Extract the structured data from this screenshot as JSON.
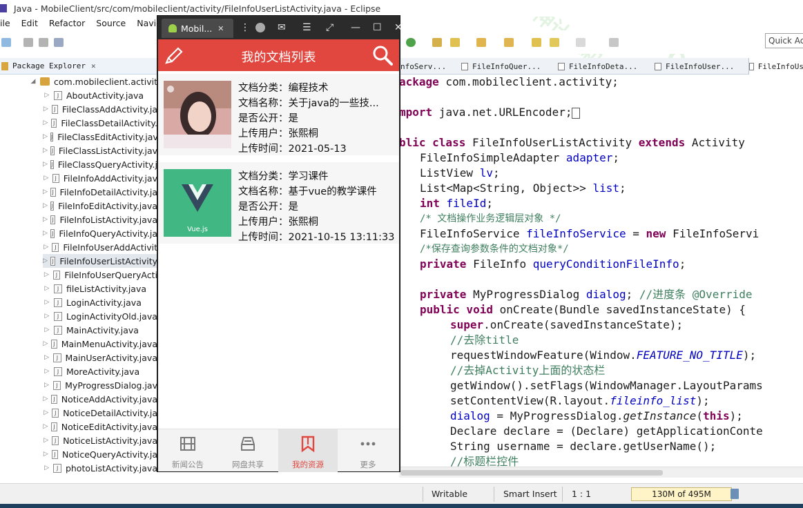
{
  "window": {
    "title": "Java - MobileClient/src/com/mobileclient/activity/FileInfoUserListActivity.java - Eclipse"
  },
  "menu": [
    "ile",
    "Edit",
    "Refactor",
    "Source",
    "Navigat"
  ],
  "quick_access": {
    "placeholder": "Quick Ac"
  },
  "package_explorer": {
    "title": "Package Explorer",
    "close": "✕",
    "package": "com.mobileclient.activity",
    "files": [
      "AboutActivity.java",
      "FileClassAddActivity.ja",
      "FileClassDetailActivity.",
      "FileClassEditActivity.jav",
      "FileClassListActivity.jav",
      "FileClassQueryActivity.j",
      "FileInfoAddActivity.jav",
      "FileInfoDetailActivity.ja",
      "FileInfoEditActivity.java",
      "FileInfoListActivity.java",
      "FileInfoQueryActivity.ja",
      "FileInfoUserAddActivit",
      "FileInfoUserListActivity",
      "FileInfoUserQueryActi",
      "fileListActivity.java",
      "LoginActivity.java",
      "LoginActivityOld.java",
      "MainActivity.java",
      "MainMenuActivity.java",
      "MainUserActivity.java",
      "MoreActivity.java",
      "MyProgressDialog.jav",
      "NoticeAddActivity.java",
      "NoticeDetailActivity.ja",
      "NoticeEditActivity.java",
      "NoticeListActivity.java",
      "NoticeQueryActivity.ja",
      "photoListActivity.java"
    ],
    "selected_index": 12
  },
  "editor_tabs": [
    "nfoServ...",
    "FileInfoQuer...",
    "FileInfoDeta...",
    "FileInfoUser...",
    "FileInfoUs"
  ],
  "code": {
    "l1": {
      "kw": "ackage",
      "rest": " com.mobileclient.activity;"
    },
    "l2": {
      "kw": "mport",
      "rest": " java.net.URLEncoder;"
    },
    "l3": {
      "kw1": "blic class",
      "mid": " FileInfoUserListActivity ",
      "kw2": "extends",
      "rest": " Activity"
    },
    "l4": {
      "type": "FileInfoSimpleAdapter ",
      "fld": "adapter",
      "end": ";"
    },
    "l5": {
      "type": "ListView ",
      "fld": "lv",
      "end": ";"
    },
    "l6": {
      "type": "List<Map<String, Object>> ",
      "fld": "list",
      "end": ";"
    },
    "l7": {
      "kw": "int ",
      "fld": "fileId",
      "end": ";"
    },
    "l8": {
      "cm": "/* 文档操作业务逻辑层对象 */"
    },
    "l9": {
      "type": "FileInfoService ",
      "fld": "fileInfoService",
      "mid": " = ",
      "kw": "new",
      "rest": " FileInfoServi"
    },
    "l10": {
      "cm": "/*保存查询参数条件的文档对象*/"
    },
    "l11": {
      "kw": "private",
      "type": " FileInfo ",
      "fld": "queryConditionFileInfo",
      "end": ";"
    },
    "l12": {
      "kw": "private",
      "type": " MyProgressDialog ",
      "fld": "dialog",
      "end": "; ",
      "cm": "//进度条 @Override"
    },
    "l13": {
      "kw": "public void",
      "rest": " onCreate(Bundle savedInstanceState) {"
    },
    "l14": {
      "kw": "super",
      "rest": ".onCreate(savedInstanceState);"
    },
    "l15": {
      "cm": "//去除title"
    },
    "l16": {
      "a": "requestWindowFeature(Window.",
      "it": "FEATURE_NO_TITLE",
      "b": ");"
    },
    "l17": {
      "cm": "//去掉Activity上面的状态栏"
    },
    "l18": {
      "a": "getWindow().setFlags(WindowManager.LayoutParams"
    },
    "l19": {
      "a": "setContentView(R.layout.",
      "it": "fileinfo_list",
      "b": ");"
    },
    "l20": {
      "fld": "dialog",
      "a": " = MyProgressDialog.",
      "it": "getInstance",
      "b": "(",
      "kw": "this",
      "c": ");"
    },
    "l21": {
      "a": "Declare declare = (Declare) getApplicationConte"
    },
    "l22": {
      "a": "String username = declare.getUserName();"
    },
    "l23": {
      "cm": "//标题栏控件"
    }
  },
  "status": {
    "writable": "Writable",
    "insert": "Smart Insert",
    "position": "1 : 1",
    "memory": "130M of 495M"
  },
  "emulator": {
    "tab_label": "Mobil...",
    "tab_close": "✕",
    "close": "✕"
  },
  "app": {
    "title": "我的文档列表",
    "accent": "#e1463f",
    "documents": [
      {
        "category": "文档分类：编程技术",
        "name": "文档名称：关于java的一些技...",
        "public": "是否公开：是",
        "user": "上传用户：张熙桐",
        "time": "上传时间：2021-05-13"
      },
      {
        "category": "文档分类：学习课件",
        "name": "文档名称：基于vue的教学课件",
        "public": "是否公开：是",
        "user": "上传用户：张熙桐",
        "time": "上传时间：2021-10-15 13:11:33",
        "logo_text": "Vue.js"
      }
    ],
    "nav": [
      {
        "label": "新闻公告",
        "icon": "film-icon"
      },
      {
        "label": "网盘共享",
        "icon": "inbox-icon"
      },
      {
        "label": "我的资源",
        "icon": "bookmark-icon"
      },
      {
        "label": "更多",
        "icon": "more-icon"
      }
    ],
    "active_nav": 2
  },
  "watermarks": [
    "QQ:254540457",
    "大神计算机设计",
    "拥有海量源码"
  ]
}
